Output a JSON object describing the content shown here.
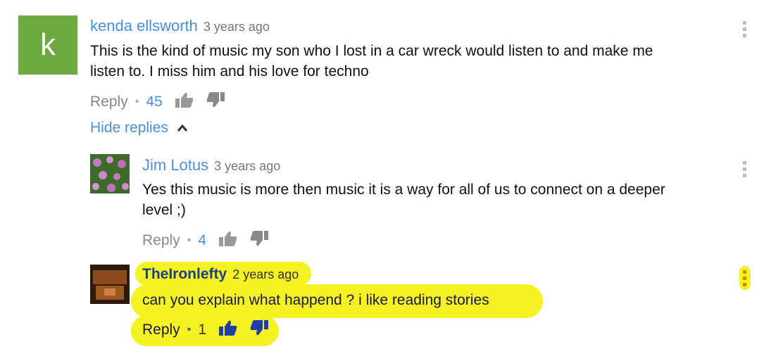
{
  "colors": {
    "link": "#4a90d9",
    "avatar_green": "#6ca93f",
    "highlight": "#f5f223"
  },
  "comments": [
    {
      "author": "kenda ellsworth",
      "time": "3 years ago",
      "avatar_letter": "k",
      "text_line1": "This is the kind of music my son who I lost in a car wreck would listen to and make me",
      "text_line2": "listen to. I miss him  and his love for techno",
      "reply_label": "Reply",
      "likes": "45",
      "hide_replies": "Hide replies"
    },
    {
      "author": "Jim Lotus",
      "time": "3 years ago",
      "text_line1": "Yes this music is more then music it is a way for all of us to connect on a deeper",
      "text_line2": "level ;)",
      "reply_label": "Reply",
      "likes": "4"
    },
    {
      "author": "TheIronlefty",
      "time": "2 years ago",
      "text_line1": "can you explain what happend ? i like reading stories",
      "reply_label": "Reply",
      "likes": "1"
    }
  ]
}
